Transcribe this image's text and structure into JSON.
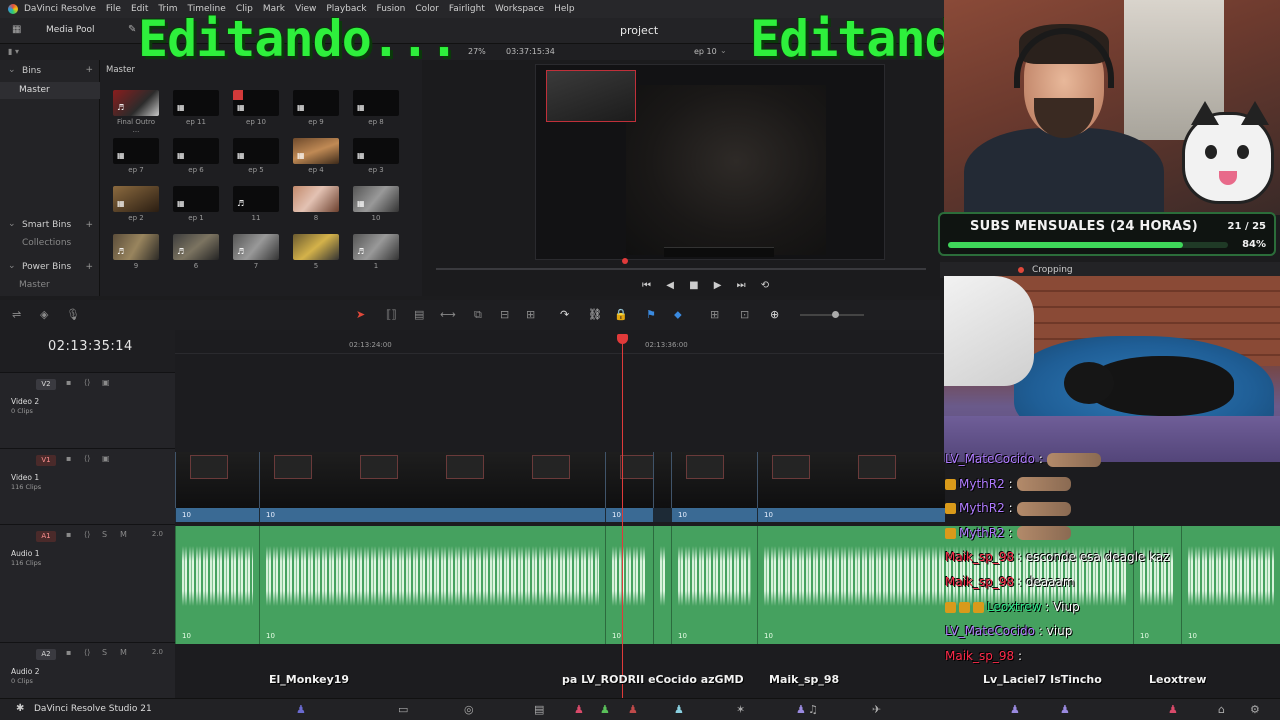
{
  "menu": {
    "app_name": "DaVinci Resolve",
    "items": [
      "File",
      "Edit",
      "Trim",
      "Timeline",
      "Clip",
      "Mark",
      "View",
      "Playback",
      "Fusion",
      "Color",
      "Fairlight",
      "Workspace",
      "Help"
    ]
  },
  "toolbar": {
    "media_pool_label": "Media Pool",
    "project_title": "project",
    "zoom": "27%",
    "timecode": "03:37:15:34",
    "timeline_name": "ep 10"
  },
  "bins": {
    "header": "Bins",
    "master": "Master",
    "smart_bins": "Smart Bins",
    "collections": "Collections",
    "power_bins": "Power Bins",
    "power_master": "Master"
  },
  "media_pool": {
    "title": "Master",
    "clips": [
      {
        "label": "Final Outro ...",
        "kind": "img1",
        "icon": "♬"
      },
      {
        "label": "ep 11",
        "kind": "dark",
        "icon": "▦"
      },
      {
        "label": "ep 10",
        "kind": "dark-red",
        "icon": "▦"
      },
      {
        "label": "ep 9",
        "kind": "dark",
        "icon": "▦"
      },
      {
        "label": "ep 8",
        "kind": "dark",
        "icon": "▦"
      },
      {
        "label": "ep 7",
        "kind": "dark",
        "icon": "▦"
      },
      {
        "label": "ep 6",
        "kind": "dark",
        "icon": "▦"
      },
      {
        "label": "ep 5",
        "kind": "dark",
        "icon": "▦"
      },
      {
        "label": "ep 4",
        "kind": "img2",
        "icon": "▦"
      },
      {
        "label": "ep 3",
        "kind": "dark",
        "icon": "▦"
      },
      {
        "label": "ep 2",
        "kind": "img3",
        "icon": "▦"
      },
      {
        "label": "ep 1",
        "kind": "dark",
        "icon": "▦"
      },
      {
        "label": "11",
        "kind": "dark",
        "icon": "♬"
      },
      {
        "label": "8",
        "kind": "img6",
        "icon": ""
      },
      {
        "label": "10",
        "kind": "img7",
        "icon": "▦"
      },
      {
        "label": "9",
        "kind": "img4",
        "icon": "♬"
      },
      {
        "label": "6",
        "kind": "img5",
        "icon": "♬"
      },
      {
        "label": "7",
        "kind": "img7",
        "icon": "♬"
      },
      {
        "label": "5",
        "kind": "img8",
        "icon": ""
      },
      {
        "label": "1",
        "kind": "img7",
        "icon": "♬"
      }
    ]
  },
  "overlay": {
    "left_text": "Editando...",
    "right_text": "Editand"
  },
  "subs_goal": {
    "title": "SUBS MENSUALES (24 HORAS)",
    "count": "21 / 25",
    "percent_label": "84%",
    "progress": 0.84
  },
  "inspector": {
    "cropping_label": "Cropping"
  },
  "timeline": {
    "current_timecode": "02:13:35:14",
    "ruler_labels": [
      "02:13:24:00",
      "02:13:36:00"
    ],
    "tracks": [
      {
        "badge": "V2",
        "name": "Video 2",
        "clips": "0 Clips"
      },
      {
        "badge": "V1",
        "name": "Video 1",
        "clips": "116 Clips"
      },
      {
        "badge": "A1",
        "name": "Audio 1",
        "clips": "116 Clips",
        "volume": "2.0"
      },
      {
        "badge": "A2",
        "name": "Audio 2",
        "clips": "0 Clips",
        "volume": "2.0"
      }
    ],
    "clip_label": "10"
  },
  "chat": [
    {
      "user": "LV_MateCocido",
      "message": ":",
      "color": "#b07cff",
      "badges": 0,
      "emote": true
    },
    {
      "user": "MythR2",
      "message": ":",
      "color": "#b07cff",
      "badges": 1,
      "emote": true
    },
    {
      "user": "MythR2",
      "message": ":",
      "color": "#b07cff",
      "badges": 1,
      "emote": true
    },
    {
      "user": "MythR2",
      "message": ":",
      "color": "#b07cff",
      "badges": 1,
      "emote": true
    },
    {
      "user": "Maik_sp_98",
      "message": ": esconde esa deagle kaz",
      "color": "#ff2a4a",
      "badges": 0,
      "emote": false
    },
    {
      "user": "Maik_sp_98",
      "message": ": deaaam",
      "color": "#ff2a4a",
      "badges": 0,
      "emote": false
    },
    {
      "user": "Leoxtrew",
      "message": ": Viup",
      "color": "#2ee88a",
      "badges": 3,
      "emote": false
    },
    {
      "user": "LV_MateCocido",
      "message": ": viup",
      "color": "#b07cff",
      "badges": 0,
      "emote": false
    },
    {
      "user": "Maik_sp_98",
      "message": ":",
      "color": "#ff2a4a",
      "badges": 0,
      "emote": false
    }
  ],
  "names_bar": [
    "El_Monkey19",
    "pa LV_RODRII eCocido azGMD",
    "Maik_sp_98",
    "Lv_Laciel7 IsTincho",
    "Leoxtrew"
  ],
  "bottom": {
    "brand": "DaVinci Resolve Studio 21"
  },
  "colors": {
    "overlay_green": "#2ef03c",
    "playhead": "#e03a3a",
    "audio_clip": "#45a15f",
    "video_clip_label": "#3a6a94"
  }
}
